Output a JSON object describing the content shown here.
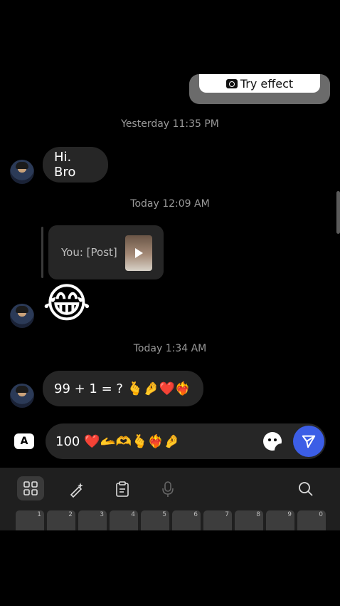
{
  "try_effect": {
    "label": "Try effect"
  },
  "messages": {
    "timestamp_1": "Yesterday 11:35 PM",
    "hi_bro": "Hi. Bro",
    "timestamp_2": "Today 12:09 AM",
    "shared_post_label": "You: [Post]",
    "laughing_emoji": "😂",
    "timestamp_3": "Today 1:34 AM",
    "equation": "99 + 1 = ? 🫰🤌❤️❤️‍🔥"
  },
  "composer": {
    "keyboard_switch_label": "A",
    "input_value": "100 ❤️🫴🫶🫰❤️‍🔥🤌"
  },
  "keyboard": {
    "key_numbers": [
      "1",
      "2",
      "3",
      "4",
      "5",
      "6",
      "7",
      "8",
      "9",
      "0"
    ]
  },
  "colors": {
    "send_button": "#3c5ee6",
    "bubble": "#262626"
  }
}
